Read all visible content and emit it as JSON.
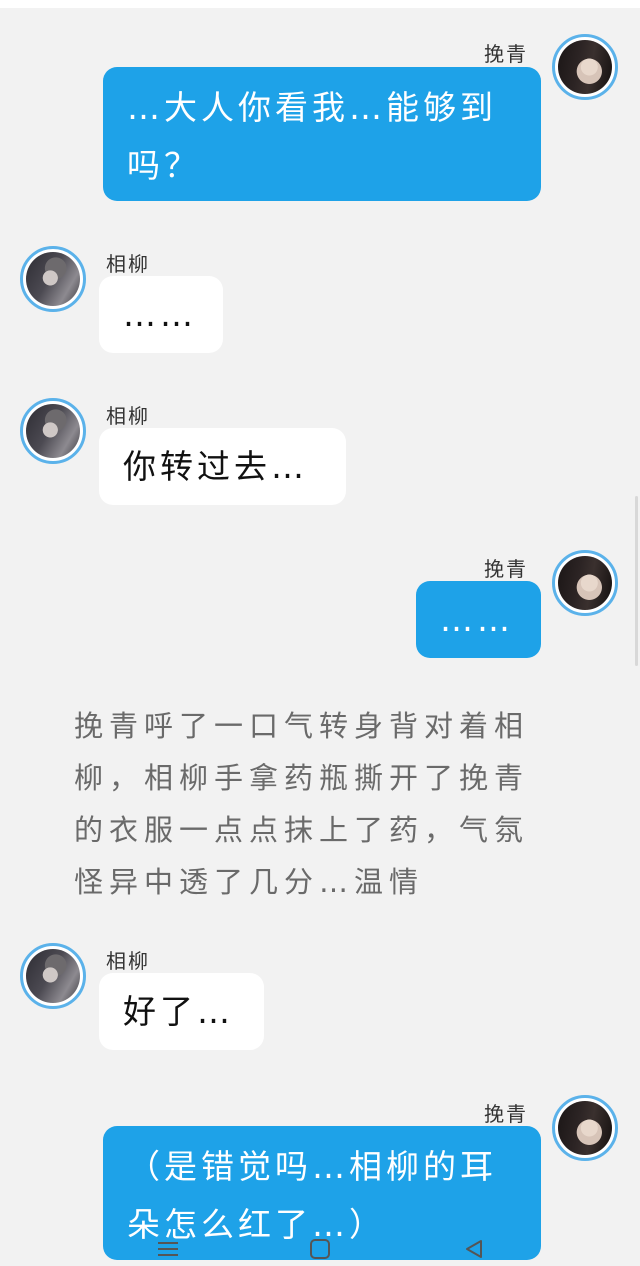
{
  "messages": [
    {
      "sender": "挽青",
      "side": "right",
      "text": "…大人你看我…能够到吗？"
    },
    {
      "sender": "相柳",
      "side": "left",
      "text": "……"
    },
    {
      "sender": "相柳",
      "side": "left",
      "text": "你转过去…"
    },
    {
      "sender": "挽青",
      "side": "right",
      "text": "……"
    },
    {
      "narration": "挽青呼了一口气转身背对着相柳，相柳手拿药瓶撕开了挽青的衣服一点点抹上了药，气氛怪异中透了几分…温情"
    },
    {
      "sender": "相柳",
      "side": "left",
      "text": "好了…"
    },
    {
      "sender": "挽青",
      "side": "right",
      "text": "（是错觉吗…相柳的耳朵怎么红了…）"
    }
  ],
  "avatars": {
    "wanqing": "avatar-wanqing",
    "xiangliu": "avatar-xiangliu"
  },
  "nav": {
    "menu_icon": "menu-icon",
    "home_icon": "home-square-icon",
    "back_icon": "back-triangle-icon"
  },
  "colors": {
    "background": "#f2f2f2",
    "right_bubble": "#1ea2e8",
    "left_bubble": "#ffffff",
    "avatar_ring": "#5bb2ea",
    "narration_text": "#6a6a6a"
  }
}
